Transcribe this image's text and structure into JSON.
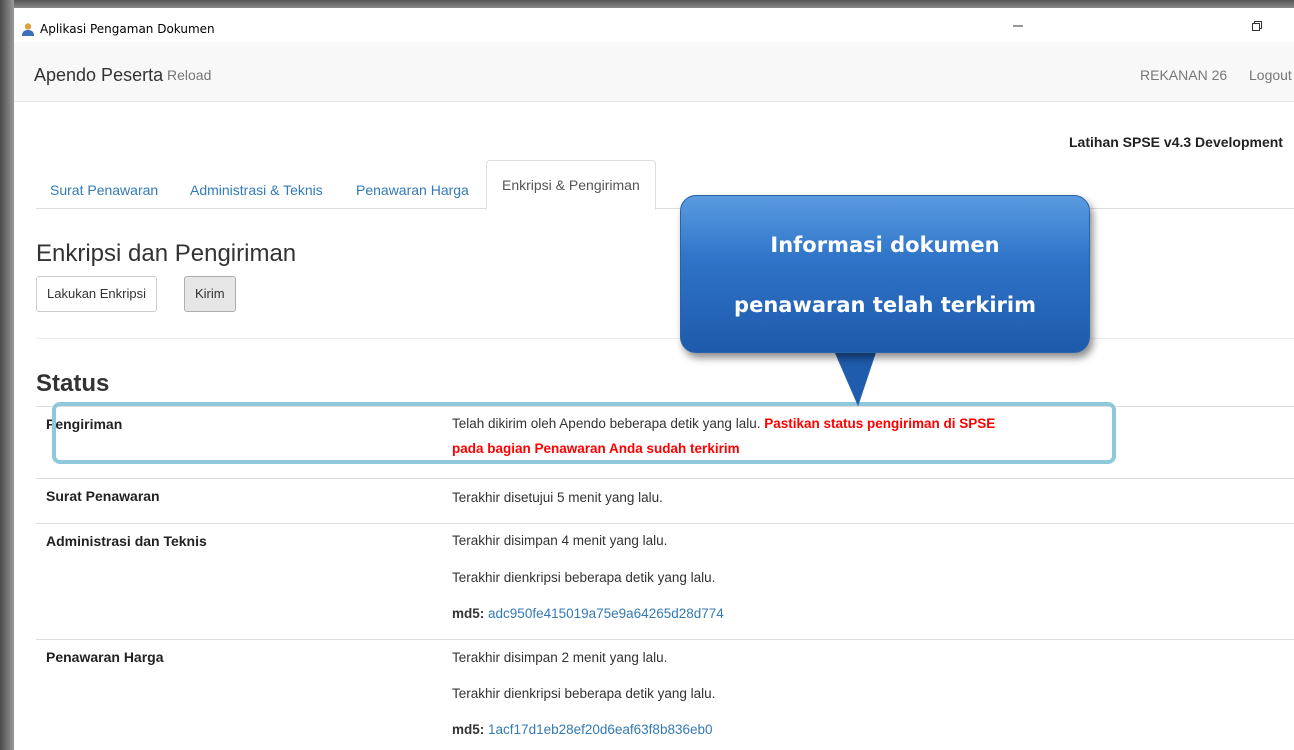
{
  "window": {
    "title": "Aplikasi Pengaman Dokumen",
    "minimize_glyph": "–",
    "maximize_glyph": "❐"
  },
  "navbar": {
    "brand": "Apendo Peserta",
    "reload": "Reload",
    "user": "REKANAN 26",
    "logout": "Logout"
  },
  "environment_title": "Latihan SPSE v4.3 Development",
  "tabs": [
    {
      "label": "Surat Penawaran"
    },
    {
      "label": "Administrasi & Teknis"
    },
    {
      "label": "Penawaran Harga"
    },
    {
      "label": "Enkripsi & Pengiriman",
      "active": true
    }
  ],
  "main": {
    "title": "Enkripsi dan Pengiriman",
    "encrypt_button": "Lakukan Enkripsi",
    "send_button": "Kirim"
  },
  "status": {
    "title": "Status",
    "rows": [
      {
        "label": "Pengiriman",
        "text": "Telah dikirim oleh Apendo beberapa detik yang lalu.",
        "warning_1": "Pastikan status pengiriman di SPSE",
        "warning_2": "pada bagian Penawaran Anda sudah terkirim"
      },
      {
        "label": "Surat Penawaran",
        "line_1": "Terakhir disetujui 5 menit yang lalu."
      },
      {
        "label": "Administrasi dan Teknis",
        "line_1": "Terakhir disimpan 4 menit yang lalu.",
        "line_2": "Terakhir dienkripsi beberapa detik yang lalu.",
        "md5_label": "md5:",
        "md5_value": "adc950fe415019a75e9a64265d28d774"
      },
      {
        "label": "Penawaran Harga",
        "line_1": "Terakhir disimpan 2 menit yang lalu.",
        "line_2": "Terakhir dienkripsi beberapa detik yang lalu.",
        "md5_label": "md5:",
        "md5_value": "1acf17d1eb28ef20d6eaf63f8b836eb0"
      }
    ]
  },
  "callout": {
    "line_1": "Informasi dokumen",
    "line_2": "penawaran telah terkirim"
  },
  "colors": {
    "link": "#337ab7",
    "warning": "#ff0000",
    "highlight_border": "#8ec8da",
    "callout_blue": "#2f74c8"
  }
}
